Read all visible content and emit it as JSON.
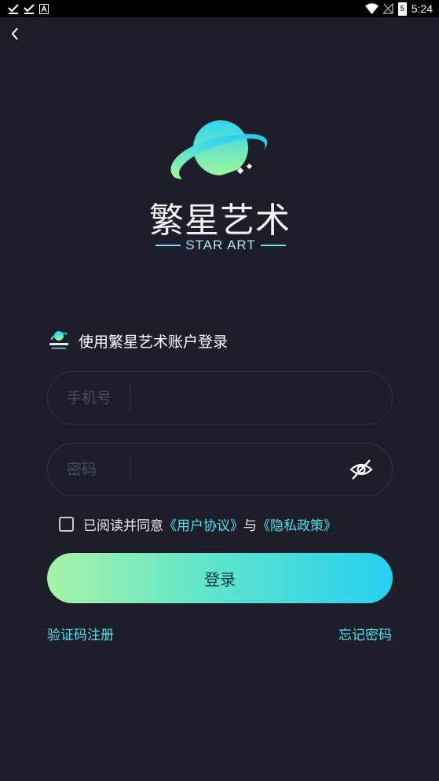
{
  "status_bar": {
    "time": "5:24",
    "battery": "5"
  },
  "brand": {
    "name_cn": "繁星艺术",
    "name_en": "STAR ART"
  },
  "login": {
    "subtitle": "使用繁星艺术账户登录",
    "phone_label": "手机号",
    "password_label": "密码",
    "agree_prefix": "已阅读并同意",
    "user_agreement": "《用户协议》",
    "and_text": "与",
    "privacy_policy": "《隐私政策》",
    "submit_label": "登录",
    "sms_register": "验证码注册",
    "forgot_password": "忘记密码"
  }
}
